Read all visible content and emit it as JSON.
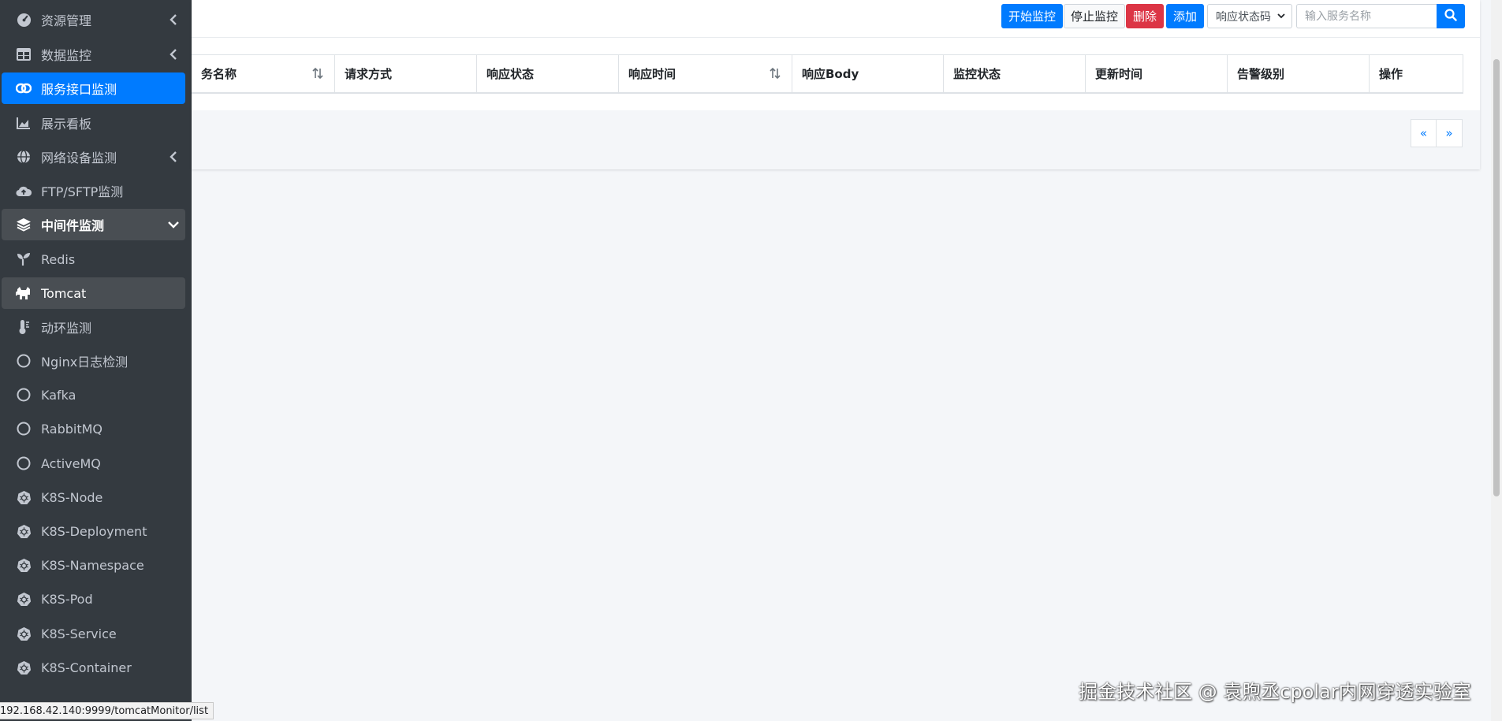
{
  "sidebar": {
    "items": [
      {
        "label": "资源管理",
        "icon": "dashboard-gauge-icon",
        "has_caret": true
      },
      {
        "label": "数据监控",
        "icon": "grid-table-icon",
        "has_caret": true
      },
      {
        "label": "服务接口监测",
        "icon": "link-icon",
        "active": true
      },
      {
        "label": "展示看板",
        "icon": "area-chart-icon"
      },
      {
        "label": "网络设备监测",
        "icon": "globe-icon",
        "has_caret": true
      },
      {
        "label": "FTP/SFTP监测",
        "icon": "cloud-upload-icon"
      },
      {
        "label": "中间件监测",
        "icon": "layers-icon",
        "expanded": true
      },
      {
        "label": "Redis",
        "icon": "seedling-icon"
      },
      {
        "label": "Tomcat",
        "icon": "cat-icon",
        "hover": true
      },
      {
        "label": "动环监测",
        "icon": "thermometer-icon"
      },
      {
        "label": "Nginx日志检测",
        "icon": "circle-icon"
      },
      {
        "label": "Kafka",
        "icon": "circle-icon"
      },
      {
        "label": "RabbitMQ",
        "icon": "circle-icon"
      },
      {
        "label": "ActiveMQ",
        "icon": "circle-icon"
      },
      {
        "label": "K8S-Node",
        "icon": "kubernetes-icon"
      },
      {
        "label": "K8S-Deployment",
        "icon": "kubernetes-icon"
      },
      {
        "label": "K8S-Namespace",
        "icon": "kubernetes-icon"
      },
      {
        "label": "K8S-Pod",
        "icon": "kubernetes-icon"
      },
      {
        "label": "K8S-Service",
        "icon": "kubernetes-icon"
      },
      {
        "label": "K8S-Container",
        "icon": "kubernetes-icon"
      }
    ]
  },
  "toolbar": {
    "start_label": "开始监控",
    "stop_label": "停止监控",
    "delete_label": "删除",
    "add_label": "添加",
    "status_select_value": "响应状态码",
    "search_placeholder": "输入服务名称"
  },
  "table": {
    "columns": [
      "务名称",
      "请求方式",
      "响应状态",
      "响应时间",
      "响应Body",
      "监控状态",
      "更新时间",
      "告警级别",
      "操作"
    ],
    "rows": []
  },
  "pagination": {
    "prev": "«",
    "next": "»"
  },
  "statusbar": {
    "url": "192.168.42.140:9999/tomcatMonitor/list"
  },
  "watermark": {
    "text": "掘金技术社区 @ 袁煦丞cpolar内网穿透实验室"
  },
  "colors": {
    "primary": "#007bff",
    "danger": "#dc3545",
    "sidebar_bg": "#343a40"
  }
}
